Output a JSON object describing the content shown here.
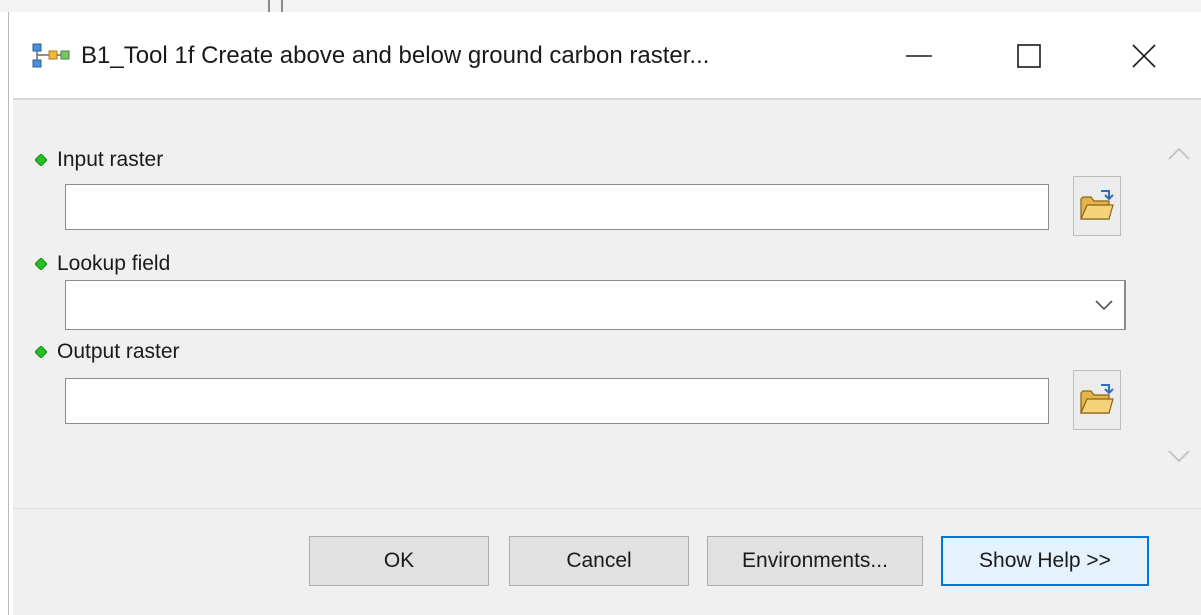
{
  "window": {
    "title": "B1_Tool 1f Create above and below ground carbon raster...",
    "controls": {
      "minimize": "minimize",
      "maximize": "maximize",
      "close": "close"
    }
  },
  "params": [
    {
      "label": "Input raster",
      "type": "text",
      "value": "",
      "required": true
    },
    {
      "label": "Lookup field",
      "type": "select",
      "value": "",
      "required": true
    },
    {
      "label": "Output raster",
      "type": "text",
      "value": "",
      "required": true
    }
  ],
  "buttons": {
    "ok": "OK",
    "cancel": "Cancel",
    "environments": "Environments...",
    "show_help": "Show Help >>"
  },
  "colors": {
    "required_dot": "#22c31f",
    "focus_border": "#0078d7"
  },
  "icons": {
    "app": "model-tool-icon",
    "browse": "open-folder-icon",
    "dropdown": "chevron-down-icon",
    "scroll_up": "chevron-up-icon",
    "scroll_down": "chevron-down-icon"
  }
}
